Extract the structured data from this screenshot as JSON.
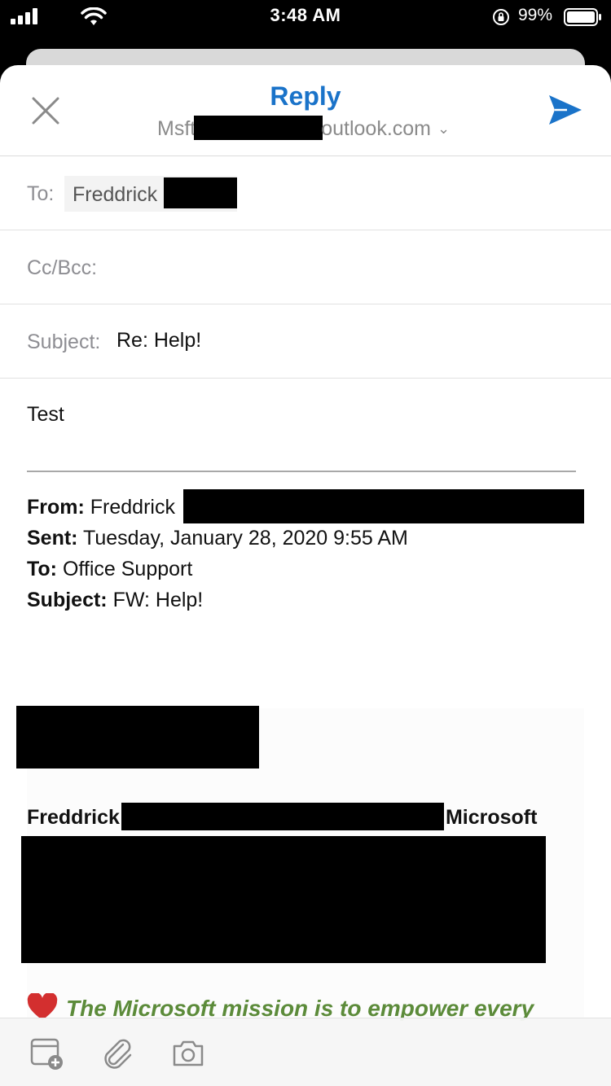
{
  "status_bar": {
    "time": "3:48 AM",
    "battery_percent": "99%",
    "icons": [
      "signal-icon",
      "wifi-icon",
      "rotation-lock-icon",
      "battery-icon"
    ]
  },
  "header": {
    "title": "Reply",
    "from_account_prefix": "Msft",
    "from_account_suffix": "outlook.com",
    "chevron": "⌄",
    "accent_color": "#1a73c9"
  },
  "fields": {
    "to_label": "To:",
    "to_recipient": "Freddrick",
    "cc_label": "Cc/Bcc:",
    "subject_label": "Subject:",
    "subject_value": "Re: Help!"
  },
  "body": {
    "text": "Test"
  },
  "quoted": {
    "from_label": "From:",
    "from_value": "Freddrick",
    "sent_label": "Sent:",
    "sent_value": "Tuesday, January 28, 2020 9:55 AM",
    "to_label": "To:",
    "to_value": "Office Support",
    "subject_label": "Subject:",
    "subject_value": "FW: Help!"
  },
  "signature": {
    "name": "Freddrick",
    "company": "Microsoft",
    "mission": "The Microsoft mission is to empower every",
    "mission_color": "#5c8b3a"
  },
  "toolbar": {
    "icons": [
      "calendar-add-icon",
      "attachment-icon",
      "camera-icon"
    ]
  }
}
